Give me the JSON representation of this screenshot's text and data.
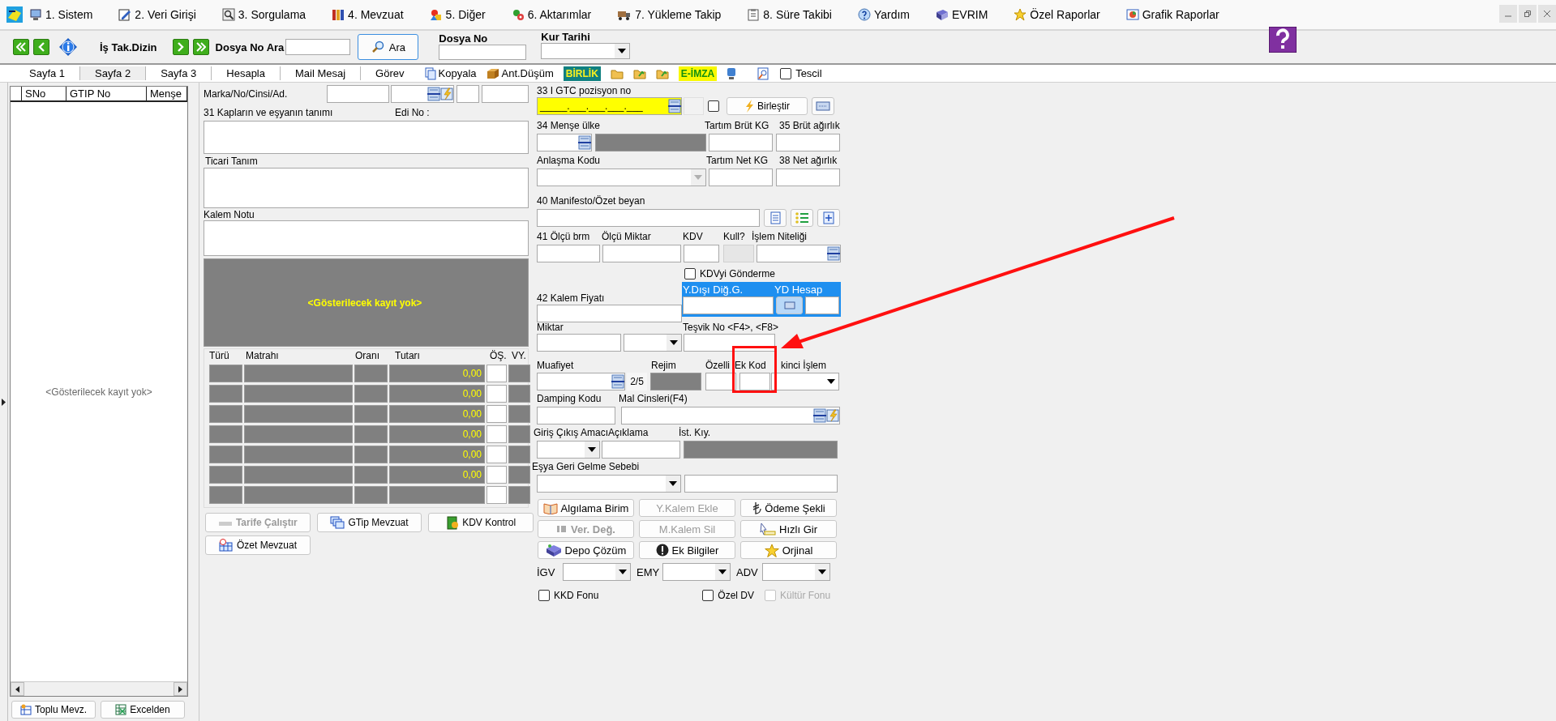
{
  "menu": [
    {
      "label": "1.  Sistem",
      "kind": "computer"
    },
    {
      "label": "2.  Veri Girişi",
      "kind": "pencil"
    },
    {
      "label": "3.  Sorgulama",
      "kind": "magnifier"
    },
    {
      "label": "4.  Mevzuat",
      "kind": "books"
    },
    {
      "label": "5.  Diğer",
      "kind": "shapes"
    },
    {
      "label": "6.  Aktarımlar",
      "kind": "gears"
    },
    {
      "label": "7.  Yükleme Takip",
      "kind": "truck"
    },
    {
      "label": "8. Süre Takibi",
      "kind": "clipboard"
    },
    {
      "label": "Yardım",
      "kind": "help"
    },
    {
      "label": "EVRIM",
      "kind": "book"
    },
    {
      "label": "Özel Raporlar",
      "kind": "star"
    },
    {
      "label": "Grafik Raporlar",
      "kind": "chart"
    }
  ],
  "toolbar": {
    "work_folder_label": "İş Tak.Dizin",
    "file_search_label": "Dosya No Ara",
    "search_button": "Ara",
    "file_no_label": "Dosya No",
    "rate_date_label": "Kur Tarihi"
  },
  "tabs": [
    {
      "label": "Sayfa 1",
      "selected": false
    },
    {
      "label": "Sayfa 2",
      "selected": true
    },
    {
      "label": "Sayfa 3",
      "selected": false
    },
    {
      "label": "Hesapla",
      "selected": false
    },
    {
      "label": "Mail Mesaj",
      "selected": false
    },
    {
      "label": "Görev",
      "selected": false
    }
  ],
  "tab_actions": {
    "copy": "Kopyala",
    "deduction": "Ant.Düşüm",
    "union_badge": "BİRLİK",
    "e_signature": "E-İMZA",
    "registration": {
      "label": "Tescil",
      "checked": false
    }
  },
  "item_list": {
    "columns": [
      "SNo",
      "GTIP No",
      "Menşe"
    ],
    "empty_text": "<Gösterilecek kayıt yok>",
    "buttons": [
      "Toplu Mevz.",
      "Excelden"
    ]
  },
  "description": {
    "mark_label": "Marka/No/Cinsi/Ad.",
    "packages_label": "31 Kapların ve eşyanın tanımı",
    "edi_label": "Edi No :",
    "trade_label": "Ticari Tanım",
    "note_label": "Kalem Notu",
    "empty_text": "<Gösterilecek kayıt yok>"
  },
  "taxes": {
    "columns": [
      "Türü",
      "Matrahı",
      "Oranı",
      "Tutarı",
      "ÖŞ.",
      "VY."
    ],
    "rows": [
      {
        "amount": "0,00"
      },
      {
        "amount": "0,00"
      },
      {
        "amount": "0,00"
      },
      {
        "amount": "0,00"
      },
      {
        "amount": "0,00"
      },
      {
        "amount": "0,00"
      },
      {
        "amount": ""
      }
    ]
  },
  "tax_buttons": [
    {
      "label": "Tarife Çalıştır",
      "disabled": true,
      "kind": "binary"
    },
    {
      "label": "GTip Mevzuat",
      "disabled": false,
      "kind": "windows"
    },
    {
      "label": "KDV Kontrol",
      "disabled": false,
      "kind": "package"
    },
    {
      "label": "Özet Mevzuat",
      "disabled": false,
      "kind": "table"
    }
  ],
  "item_form": {
    "gtc_label": "33 I GTC pozisyon no",
    "gtc_value": "_____.___.___.___.___",
    "gtc_check": {
      "checked": false
    },
    "merge_button": "Birleştir",
    "origin_label": "34 Menşe ülke",
    "gross_weigh_label": "Tartım Brüt KG",
    "gross_label": "35 Brüt ağırlık",
    "agreement_label": "Anlaşma Kodu",
    "net_weigh_label": "Tartım Net KG",
    "net_label": "38 Net ağırlık",
    "manifest_label": "40 Manifesto/Özet beyan",
    "unit_label": "41 Ölçü brm",
    "measure_label": "Ölçü Miktar",
    "vat_label": "KDV",
    "used_label": "Kull?",
    "operation_label": "İşlem Niteliği",
    "vat_send": {
      "label": "KDVyi Gönderme",
      "checked": false
    },
    "price_label": "42 Kalem Fiyatı",
    "foreign_label": "Y.Dışı Diğ.G.",
    "foreign_account_label": "YD Hesap",
    "quantity_label": "Miktar",
    "incentive_label": "Teşvik No <F4>, <F8>",
    "exemption_label": "Muafiyet",
    "exemption_count": "2/5",
    "regime_label": "Rejim",
    "feature_label": "Özelli",
    "extra_code_label": "Ek Kod",
    "second_label": "kinci İşlem",
    "dumping_label": "Damping Kodu",
    "goods_label": "Mal Cinsleri(F4)",
    "purpose_label": "Giriş Çıkış Amacı",
    "explanation_label": "Açıklama",
    "stat_label": "İst. Kıy.",
    "return_label": "Eşya Geri Gelme Sebebi"
  },
  "item_buttons": [
    {
      "label": "Algılama Birim",
      "disabled": false,
      "kind": "book"
    },
    {
      "label": "Y.Kalem Ekle",
      "disabled": true,
      "kind": "none"
    },
    {
      "label": "Ödeme Şekli",
      "disabled": false,
      "kind": "lira"
    },
    {
      "label": "Ver. Değ.",
      "disabled": true,
      "kind": "number"
    },
    {
      "label": "M.Kalem Sil",
      "disabled": true,
      "kind": "none"
    },
    {
      "label": "Hızlı Gir",
      "disabled": false,
      "kind": "cursor"
    },
    {
      "label": "Depo Çözüm",
      "disabled": false,
      "kind": "box"
    },
    {
      "label": "Ek Bilgiler",
      "disabled": false,
      "kind": "alert"
    },
    {
      "label": "Orjinal",
      "disabled": false,
      "kind": "star"
    }
  ],
  "fund_combos": [
    "İGV",
    "EMY",
    "ADV"
  ],
  "fund_checks": [
    {
      "label": "KKD Fonu",
      "checked": false,
      "disabled": false
    },
    {
      "label": "Özel DV",
      "checked": false,
      "disabled": false
    },
    {
      "label": "Kültür Fonu",
      "checked": false,
      "disabled": true
    }
  ]
}
